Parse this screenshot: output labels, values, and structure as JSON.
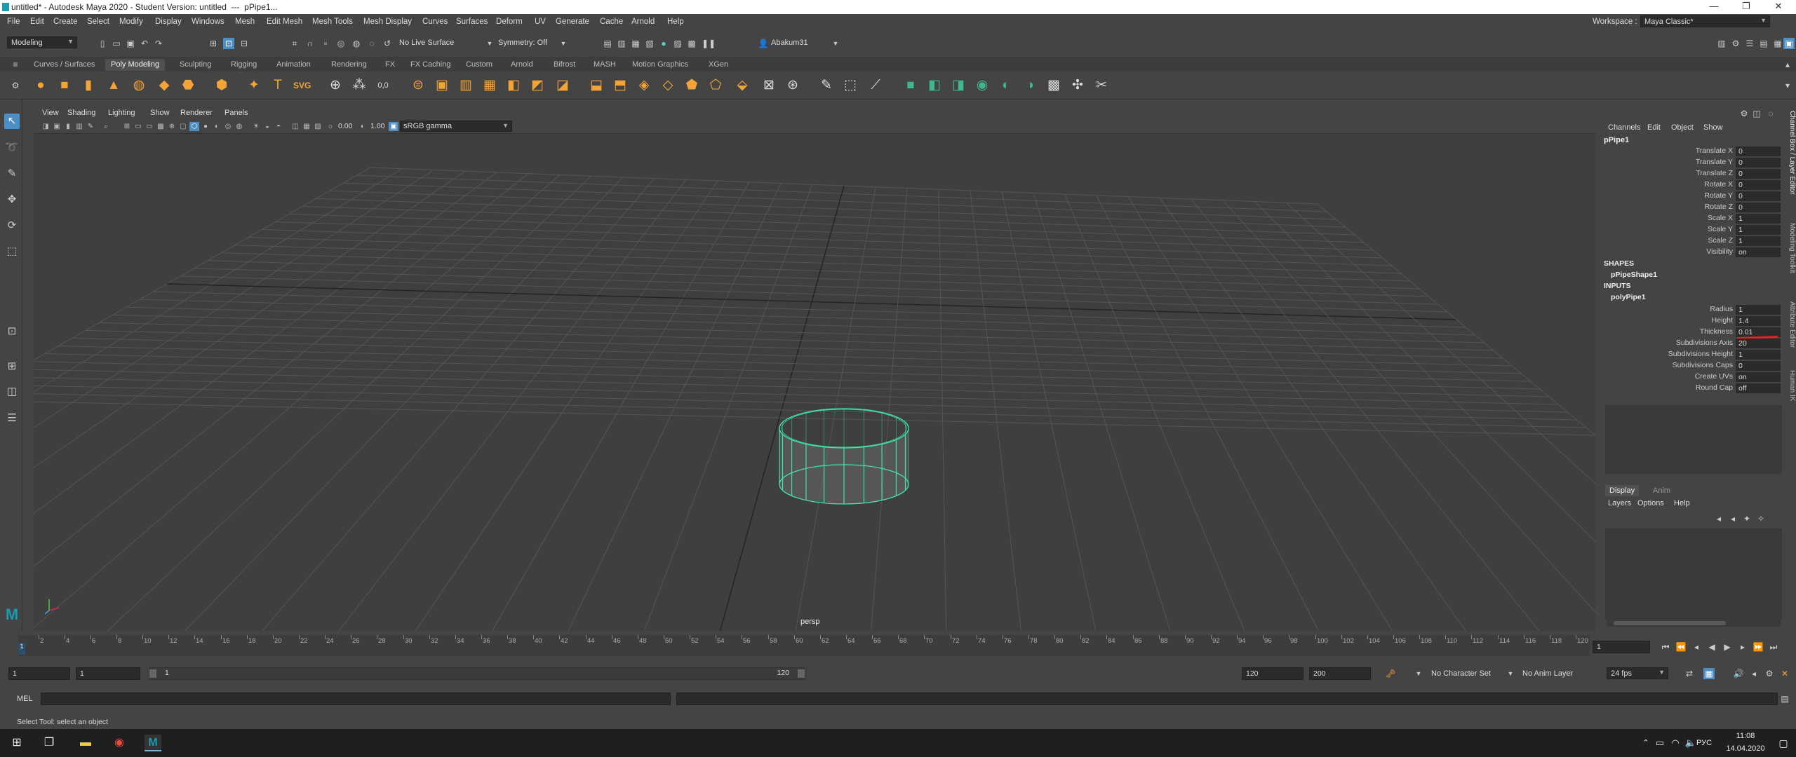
{
  "window": {
    "title": "untitled* - Autodesk Maya 2020 - Student Version: untitled  ---  pPipe1...",
    "controls": [
      "—",
      "❐",
      "✕"
    ]
  },
  "menubar": {
    "items": [
      "File",
      "Edit",
      "Create",
      "Select",
      "Modify",
      "Display",
      "Windows",
      "Mesh",
      "Edit Mesh",
      "Mesh Tools",
      "Mesh Display",
      "Curves",
      "Surfaces",
      "Deform",
      "UV",
      "Generate",
      "Cache",
      "Arnold",
      "Help"
    ],
    "workspace_label": "Workspace :",
    "workspace_value": "Maya Classic*"
  },
  "statusline": {
    "menuset": "Modeling",
    "live_surface": "No Live Surface",
    "symmetry": "Symmetry: Off",
    "user": "Abakum31"
  },
  "shelf": {
    "tabs": [
      "Curves / Surfaces",
      "Poly Modeling",
      "Sculpting",
      "Rigging",
      "Animation",
      "Rendering",
      "FX",
      "FX Caching",
      "Custom",
      "Arnold",
      "Bifrost",
      "MASH",
      "Motion Graphics",
      "XGen"
    ],
    "active_tab": "Poly Modeling"
  },
  "panel": {
    "menus": [
      "View",
      "Shading",
      "Lighting",
      "Show",
      "Renderer",
      "Panels"
    ],
    "near_clip": "0.00",
    "far_value": "1.00",
    "color_space": "sRGB gamma",
    "camera_label": "persp"
  },
  "channelbox": {
    "menus": [
      "Channels",
      "Edit",
      "Object",
      "Show"
    ],
    "object_name": "pPipe1",
    "transform_attrs": [
      {
        "label": "Translate X",
        "value": "0"
      },
      {
        "label": "Translate Y",
        "value": "0"
      },
      {
        "label": "Translate Z",
        "value": "0"
      },
      {
        "label": "Rotate X",
        "value": "0"
      },
      {
        "label": "Rotate Y",
        "value": "0"
      },
      {
        "label": "Rotate Z",
        "value": "0"
      },
      {
        "label": "Scale X",
        "value": "1"
      },
      {
        "label": "Scale Y",
        "value": "1"
      },
      {
        "label": "Scale Z",
        "value": "1"
      },
      {
        "label": "Visibility",
        "value": "on"
      }
    ],
    "shapes_header": "SHAPES",
    "shape_name": "pPipeShape1",
    "inputs_header": "INPUTS",
    "input_name": "polyPipe1",
    "input_attrs": [
      {
        "label": "Radius",
        "value": "1"
      },
      {
        "label": "Height",
        "value": "1.4"
      },
      {
        "label": "Thickness",
        "value": "0.01"
      },
      {
        "label": "Subdivisions Axis",
        "value": "20"
      },
      {
        "label": "Subdivisions Height",
        "value": "1"
      },
      {
        "label": "Subdivisions Caps",
        "value": "0"
      },
      {
        "label": "Create UVs",
        "value": "on"
      },
      {
        "label": "Round Cap",
        "value": "off"
      }
    ]
  },
  "layer_editor": {
    "tabs": [
      "Display",
      "Anim"
    ],
    "menus": [
      "Layers",
      "Options",
      "Help"
    ]
  },
  "side_tabs": [
    "Channel Box / Layer Editor",
    "Modeling Toolkit",
    "Attribute Editor",
    "Human IK"
  ],
  "timeline": {
    "ticks": [
      "2",
      "4",
      "6",
      "8",
      "10",
      "12",
      "14",
      "16",
      "18",
      "20",
      "22",
      "24",
      "26",
      "28",
      "30",
      "32",
      "34",
      "36",
      "38",
      "40",
      "42",
      "44",
      "46",
      "48",
      "50",
      "52",
      "54",
      "56",
      "58",
      "60",
      "62",
      "64",
      "66",
      "68",
      "70",
      "72",
      "74",
      "76",
      "78",
      "80",
      "82",
      "84",
      "86",
      "88",
      "90",
      "92",
      "94",
      "96",
      "98",
      "100",
      "102",
      "104",
      "106",
      "108",
      "110",
      "112",
      "114",
      "116",
      "118",
      "120"
    ],
    "current_frame": "1",
    "current_frame_field": "1"
  },
  "range": {
    "start": "1",
    "start2": "1",
    "slider_start": "1",
    "slider_end": "120",
    "end": "120",
    "end2": "200",
    "character_set": "No Character Set",
    "anim_layer": "No Anim Layer",
    "fps": "24 fps"
  },
  "cmdline": {
    "label": "MEL"
  },
  "helpline": {
    "text": "Select Tool: select an object"
  },
  "taskbar": {
    "lang": "РУС",
    "time": "11:08",
    "date": "14.04.2020"
  },
  "colors": {
    "accent": "#4c8fc6",
    "shelf_icon": "#f4a437",
    "wireframe": "#3fe6a6",
    "highlight": "#e02020"
  }
}
